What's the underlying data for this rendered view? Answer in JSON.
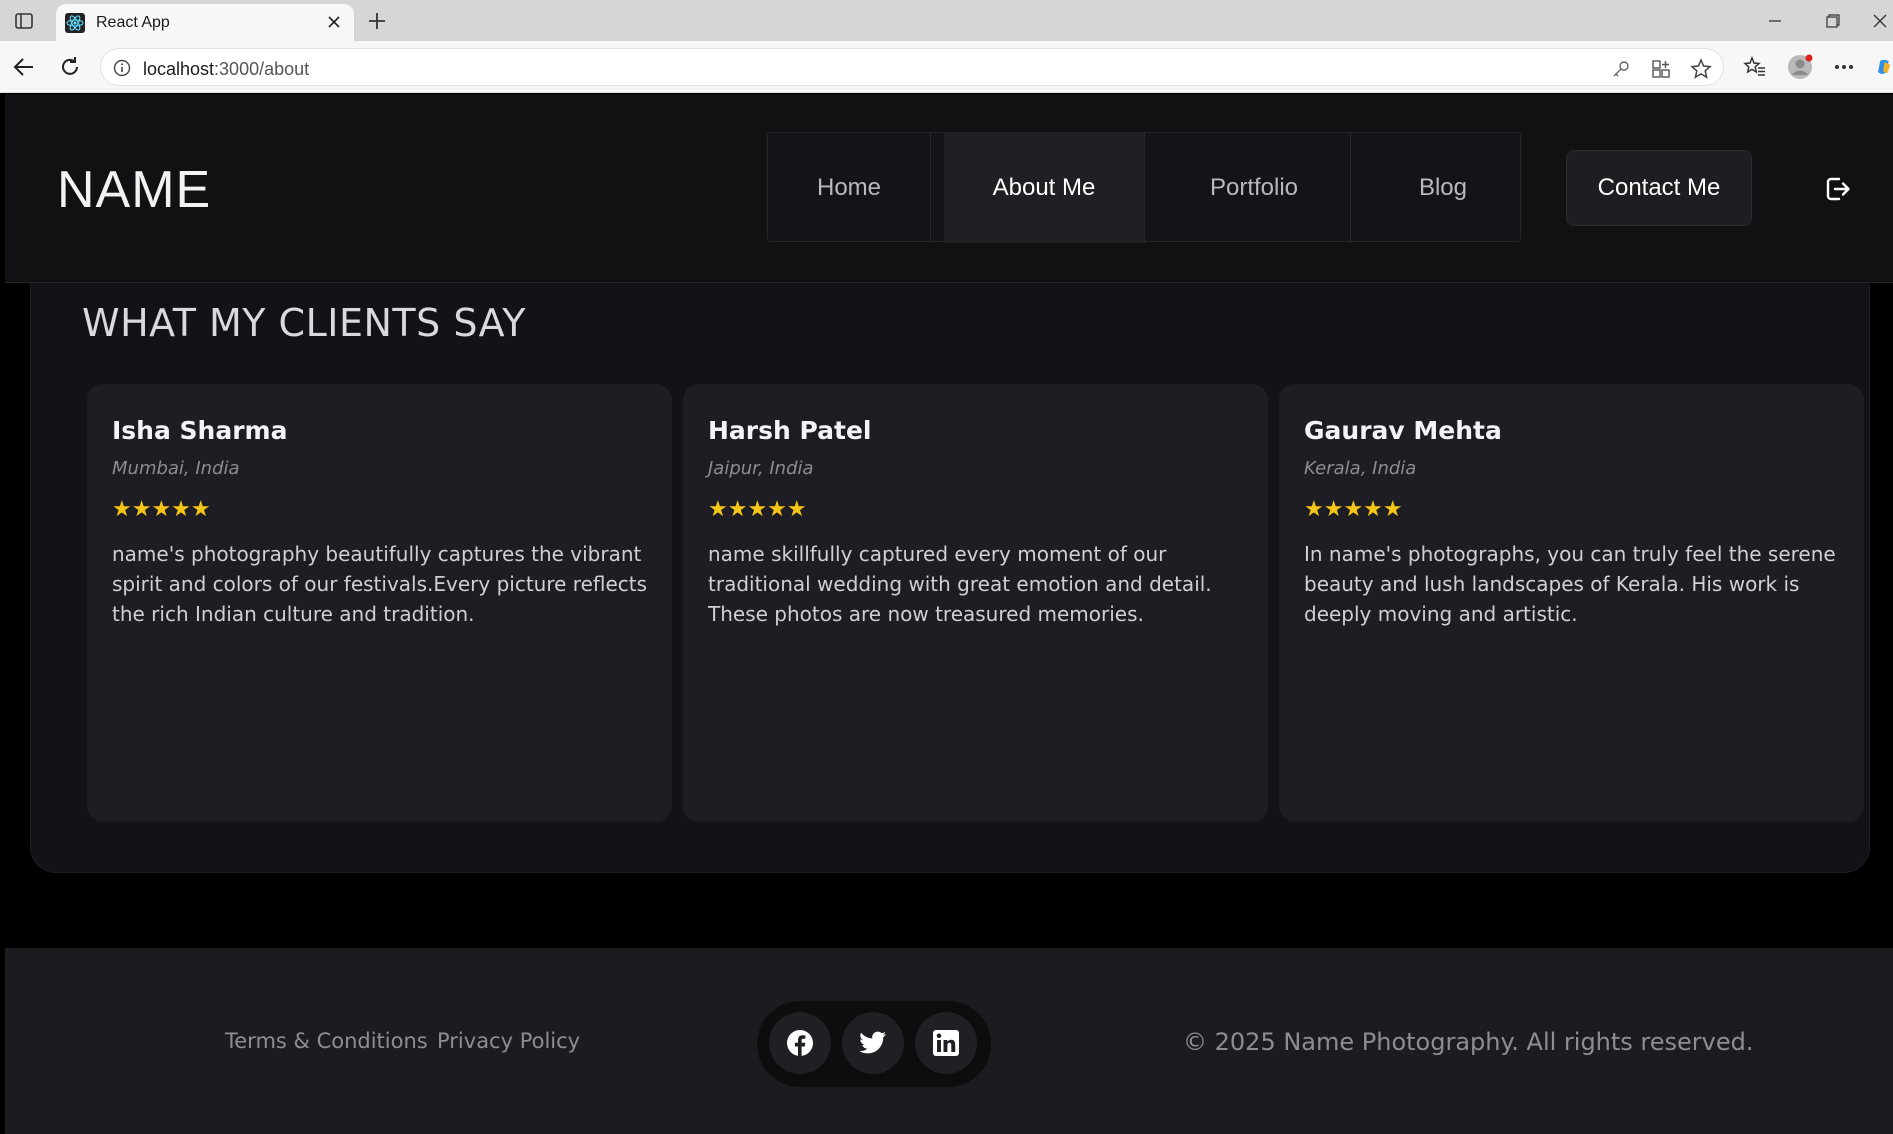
{
  "browser": {
    "tab_title": "React App",
    "url_host": "localhost",
    "url_path": ":3000/about",
    "icons": [
      "sidebar-toggle-icon",
      "react-favicon",
      "close-icon",
      "plus-icon",
      "minimize-icon",
      "restore-icon",
      "back-icon",
      "reload-icon",
      "info-icon",
      "key-icon",
      "apps-icon",
      "star-icon",
      "favorites-icon",
      "profile-icon",
      "more-icon"
    ]
  },
  "nav": {
    "logo": "NAME",
    "links": [
      "Home",
      "About Me",
      "Portfolio",
      "Blog"
    ],
    "active_link": "About Me",
    "contact": "Contact Me",
    "logout_icon": "logout-icon"
  },
  "testimonials": {
    "title": "WHAT MY CLIENTS SAY",
    "star_color": "#f5c518",
    "cards": [
      {
        "name": "Isha Sharma",
        "location": "Mumbai, India",
        "stars": "★★★★★",
        "rating": 5,
        "text": "name's photography beautifully captures the vibrant spirit and colors of our festivals.Every picture reflects the rich Indian culture and tradition."
      },
      {
        "name": "Harsh Patel",
        "location": "Jaipur, India",
        "stars": "★★★★★",
        "rating": 5,
        "text": "name skillfully captured every moment of our traditional wedding with great emotion and detail. These photos are now treasured memories."
      },
      {
        "name": "Gaurav Mehta",
        "location": "Kerala, India",
        "stars": "★★★★★",
        "rating": 5,
        "text": "In name's photographs, you can truly feel the serene beauty and lush landscapes of Kerala. His work is deeply moving and artistic."
      }
    ]
  },
  "footer": {
    "terms": "Terms & Conditions",
    "privacy": "Privacy Policy",
    "social": [
      "facebook-icon",
      "twitter-icon",
      "linkedin-icon"
    ],
    "copyright": "© 2025 Name Photography. All rights reserved."
  }
}
